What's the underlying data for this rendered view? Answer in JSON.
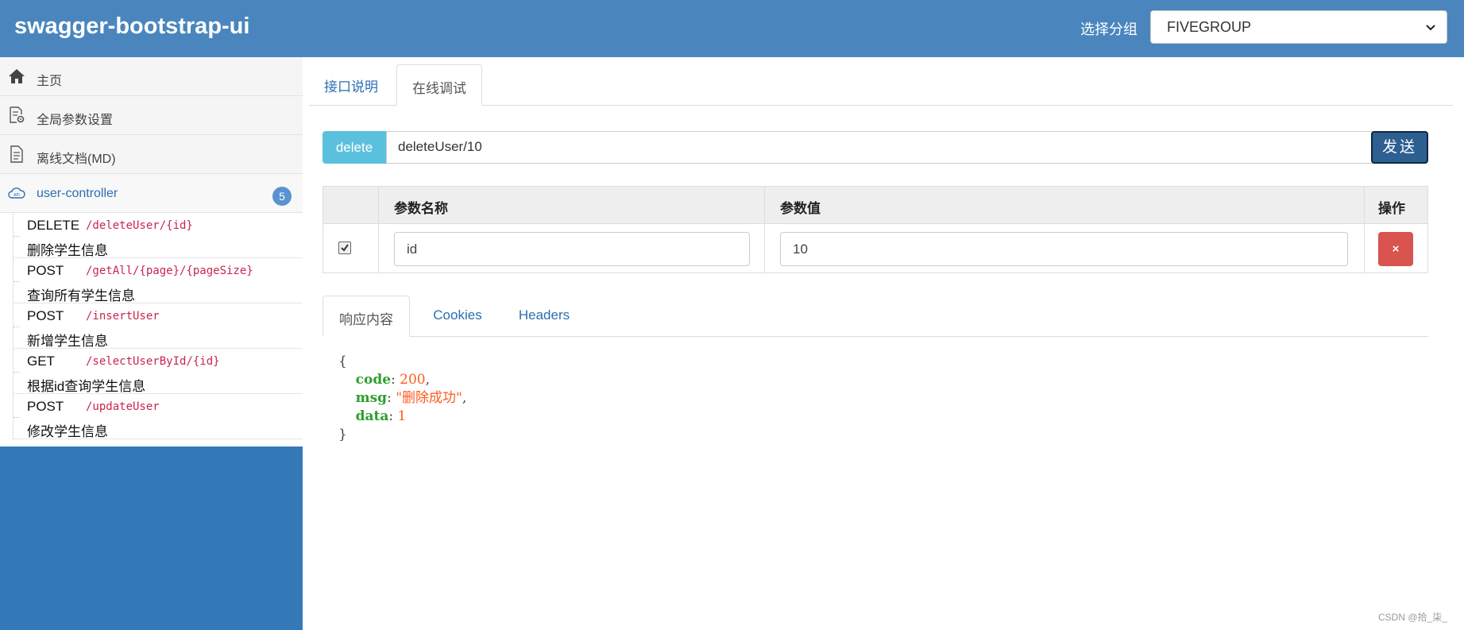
{
  "header": {
    "brand": "swagger-bootstrap-ui",
    "group_label": "选择分组",
    "group_selected": "FIVEGROUP"
  },
  "sidebar": {
    "menu": [
      {
        "label": "主页",
        "icon": "home-icon"
      },
      {
        "label": "全局参数设置",
        "icon": "doc-settings-icon"
      },
      {
        "label": "离线文档(MD)",
        "icon": "document-icon"
      }
    ],
    "controller": {
      "label": "user-controller",
      "icon": "cloud-api-icon",
      "count": "5"
    },
    "apis": [
      {
        "method": "DELETE",
        "path": "/deleteUser/{id}",
        "desc": "删除学生信息"
      },
      {
        "method": "POST",
        "path": "/getAll/{page}/{pageSize}",
        "desc": "查询所有学生信息"
      },
      {
        "method": "POST",
        "path": "/insertUser",
        "desc": "新增学生信息"
      },
      {
        "method": "GET",
        "path": "/selectUserById/{id}",
        "desc": "根据id查询学生信息"
      },
      {
        "method": "POST",
        "path": "/updateUser",
        "desc": "修改学生信息"
      }
    ]
  },
  "main": {
    "tabs": [
      {
        "label": "接口说明"
      },
      {
        "label": "在线调试"
      }
    ],
    "request": {
      "method": "delete",
      "url": "deleteUser/10",
      "send_label": "发送"
    },
    "params": {
      "headers": [
        "参数名称",
        "参数值",
        "操作"
      ],
      "rows": [
        {
          "checked": true,
          "name": "id",
          "value": "10",
          "delete_label": "×"
        }
      ]
    },
    "response_tabs": [
      {
        "label": "响应内容"
      },
      {
        "label": "Cookies"
      },
      {
        "label": "Headers"
      }
    ],
    "response": {
      "open": "{",
      "close": "}",
      "fields": [
        {
          "key": "code",
          "value": "200",
          "suffix": ","
        },
        {
          "key": "msg",
          "value": "\"删除成功\"",
          "suffix": ","
        },
        {
          "key": "data",
          "value": "1",
          "suffix": ""
        }
      ]
    }
  },
  "watermark": "CSDN @拾_柒_",
  "colors": {
    "header_bg": "#4a86bd",
    "sidebar_bg": "#357ab8",
    "method_badge": "#5bc0de",
    "send_button": "#2e5f91",
    "delete_button": "#d9534f",
    "json_key": "#2e9e2e",
    "json_value": "#ff5a1f"
  }
}
